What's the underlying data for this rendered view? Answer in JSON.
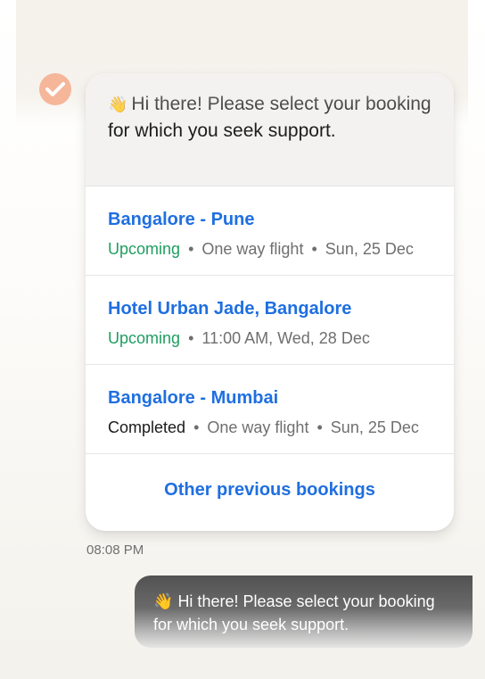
{
  "bot_message": {
    "emoji": "👋",
    "text": "Hi there! Please select your booking for which you seek support."
  },
  "bookings": [
    {
      "title": "Bangalore - Pune",
      "status": "Upcoming",
      "details": [
        "One way flight",
        "Sun, 25 Dec"
      ]
    },
    {
      "title": "Hotel Urban Jade, Bangalore",
      "status": "Upcoming",
      "details": [
        "11:00 AM, Wed, 28 Dec"
      ]
    },
    {
      "title": "Bangalore - Mumbai",
      "status": "Completed",
      "details": [
        "One way flight",
        "Sun, 25 Dec"
      ]
    }
  ],
  "other_bookings_label": "Other previous bookings",
  "timestamp": "08:08 PM",
  "separator": "•",
  "user_message": {
    "emoji": "👋",
    "text": "Hi there! Please select your booking for which you seek support."
  },
  "colors": {
    "accent_blue": "#1f6fe0",
    "status_upcoming": "#1f9e61",
    "status_completed": "#1b1b1b",
    "avatar": "#f6b699"
  }
}
